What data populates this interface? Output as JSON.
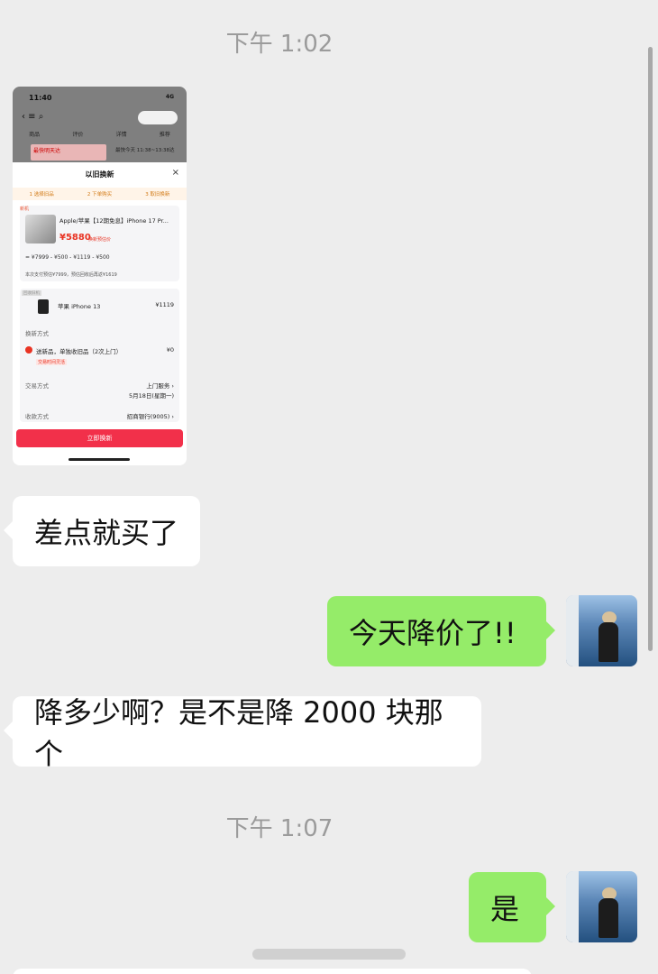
{
  "chat": {
    "timestamp_1": "下午 1:02",
    "timestamp_2": "下午 1:07",
    "messages": [
      {
        "side": "left",
        "text": "差点就买了"
      },
      {
        "side": "right",
        "text": "今天降价了!!"
      },
      {
        "side": "left",
        "text": "降多少啊？是不是降 2000 块那个"
      },
      {
        "side": "right",
        "text": "是"
      }
    ]
  },
  "screenshot": {
    "time": "11:40",
    "signal": "4G",
    "tabs": [
      "商品",
      "评价",
      "详情",
      "推荐"
    ],
    "promo_title": "最快明天达",
    "promo_sub": "最快今天 11:38~13:38达",
    "sheet_title": "以旧换新",
    "steps": [
      "1 选择旧品",
      "2 下单购买",
      "3 取旧换新"
    ],
    "new_tag": "新机",
    "product_name": "Apple/苹果【12期免息】iPhone 17 Pr...",
    "price": "¥5880",
    "price_note": "换新预估价",
    "calc": "= ¥7999 - ¥500 - ¥1119 - ¥500",
    "calc_note": "本次支付预估¥7999，预估回收后再返¥1619",
    "old_tag": "回收旧机",
    "old_name": "苹果 iPhone 13",
    "old_value": "¥1119",
    "method_label": "换新方式",
    "option": "送新品，单独收旧品（2次上门）",
    "option_value": "¥0",
    "option_tag": "交易时间灵活",
    "trade_label": "交易方式",
    "trade_value": "上门服务 ›",
    "trade_date": "5月18日(星期一)",
    "pay_label": "收款方式",
    "pay_value": "招商银行(9005) ›",
    "button": "立即换新"
  }
}
